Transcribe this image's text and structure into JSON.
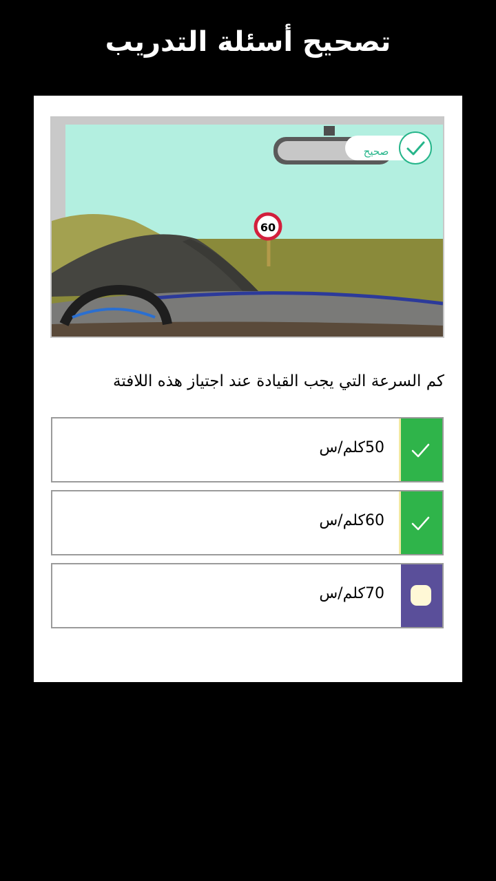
{
  "header": {
    "title": "تصحيح أسئلة التدريب"
  },
  "scene": {
    "sign_value": "60",
    "badge_label": "صحيح",
    "colors": {
      "sky": "#b3efe0",
      "grass": "#8a8a3a",
      "road": "#2f2f2f",
      "dashboard": "#6a6a6a",
      "sign_ring": "#d21f3c"
    }
  },
  "question": {
    "text": "كم السرعة التي يجب القيادة عند اجتياز هذه اللافتة"
  },
  "options": [
    {
      "text": "50كلم/س",
      "state": "correct",
      "indicator_icon": "check-icon"
    },
    {
      "text": "60كلم/س",
      "state": "correct",
      "indicator_icon": "check-icon"
    },
    {
      "text": "70كلم/س",
      "state": "unselected",
      "indicator_icon": "radio-dot-icon"
    }
  ],
  "colors": {
    "correct": "#2fb44a",
    "neutral": "#5a4f9a",
    "badge_accent": "#26b58a",
    "background": "#000000"
  }
}
